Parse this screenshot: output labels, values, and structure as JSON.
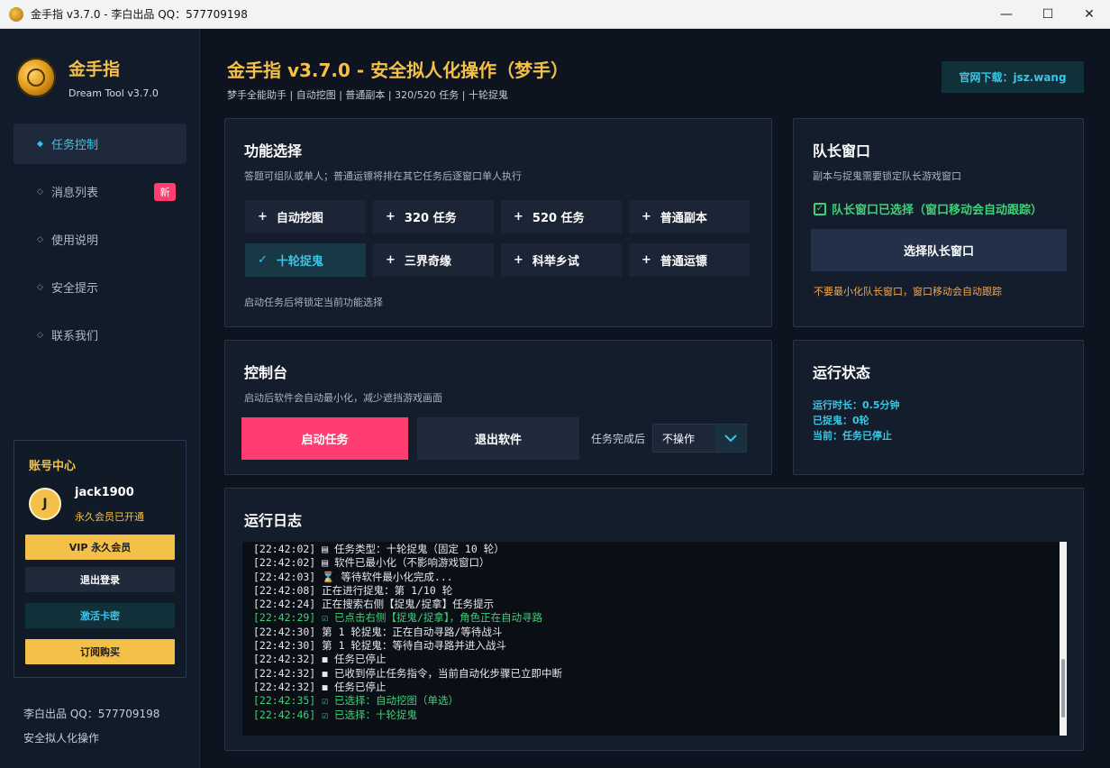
{
  "window": {
    "title": "金手指 v3.7.0 - 李白出品 QQ：577709198",
    "minimize_glyph": "—",
    "maximize_glyph": "☐",
    "close_glyph": "✕"
  },
  "brand": {
    "name": "金手指",
    "subtitle": "Dream Tool v3.7.0"
  },
  "nav": {
    "items": [
      {
        "label": "任务控制",
        "active": true
      },
      {
        "label": "消息列表",
        "badge": "新"
      },
      {
        "label": "使用说明"
      },
      {
        "label": "安全提示"
      },
      {
        "label": "联系我们"
      }
    ]
  },
  "account": {
    "title": "账号中心",
    "avatar_letter": "J",
    "username": "jack1900",
    "membership": "永久会员已开通",
    "vip_label": "VIP 永久会员",
    "logout_label": "退出登录",
    "activate_label": "激活卡密",
    "buy_label": "订阅购买"
  },
  "footer": {
    "author": "李白出品 QQ：577709198",
    "tagline": "安全拟人化操作"
  },
  "header": {
    "title": "金手指 v3.7.0 - 安全拟人化操作（梦手）",
    "subtitle": "梦手全能助手 | 自动挖图 | 普通副本 | 320/520 任务 | 十轮捉鬼",
    "site_button": "官网下载：jsz.wang"
  },
  "functions": {
    "title": "功能选择",
    "desc": "答题可组队或单人；普通运镖将排在其它任务后逐窗口单人执行",
    "items": [
      {
        "label": "自动挖图",
        "mark": "+"
      },
      {
        "label": "320 任务",
        "mark": "+"
      },
      {
        "label": "520 任务",
        "mark": "+"
      },
      {
        "label": "普通副本",
        "mark": "+"
      },
      {
        "label": "十轮捉鬼",
        "mark": "✓",
        "selected": true
      },
      {
        "label": "三界奇缘",
        "mark": "+"
      },
      {
        "label": "科举乡试",
        "mark": "+"
      },
      {
        "label": "普通运镖",
        "mark": "+"
      }
    ],
    "note": "启动任务后将锁定当前功能选择"
  },
  "leader": {
    "title": "队长窗口",
    "desc": "副本与捉鬼需要锁定队长游戏窗口",
    "status": "队长窗口已选择（窗口移动会自动跟踪）",
    "select_button": "选择队长窗口",
    "warning": "不要最小化队长窗口，窗口移动会自动跟踪",
    "status_color": "#3cd177"
  },
  "console": {
    "title": "控制台",
    "desc": "启动后软件会自动最小化，减少遮挡游戏画面",
    "start_label": "启动任务",
    "exit_label": "退出软件",
    "after_label": "任务完成后",
    "after_value": "不操作"
  },
  "status": {
    "title": "运行状态",
    "runtime": "运行时长：0.5分钟",
    "caught": "已捉鬼：0轮",
    "current": "当前：任务已停止"
  },
  "log": {
    "title": "运行日志",
    "lines": [
      {
        "text": "[22:42:02] ▤ 任务类型：十轮捉鬼（固定 10 轮）",
        "color": "white"
      },
      {
        "text": "[22:42:02] ▤ 软件已最小化（不影响游戏窗口）",
        "color": "white"
      },
      {
        "text": "[22:42:03] ⌛ 等待软件最小化完成...",
        "color": "white"
      },
      {
        "text": "[22:42:08] 正在进行捉鬼：第 1/10 轮",
        "color": "white"
      },
      {
        "text": "[22:42:24] 正在搜索右侧【捉鬼/捉拿】任务提示",
        "color": "white"
      },
      {
        "text": "[22:42:29] ☑ 已点击右侧【捉鬼/捉拿】，角色正在自动寻路",
        "color": "green"
      },
      {
        "text": "[22:42:30] 第 1 轮捉鬼：正在自动寻路/等待战斗",
        "color": "white"
      },
      {
        "text": "[22:42:30] 第 1 轮捉鬼：等待自动寻路并进入战斗",
        "color": "white"
      },
      {
        "text": "[22:42:32] ◼ 任务已停止",
        "color": "white"
      },
      {
        "text": "[22:42:32] ◼ 已收到停止任务指令，当前自动化步骤已立即中断",
        "color": "white"
      },
      {
        "text": "[22:42:32] ◼ 任务已停止",
        "color": "white"
      },
      {
        "text": "[22:42:35] ☑ 已选择：自动挖图（单选）",
        "color": "green"
      },
      {
        "text": "[22:42:46] ☑ 已选择：十轮捉鬼",
        "color": "green"
      }
    ]
  }
}
